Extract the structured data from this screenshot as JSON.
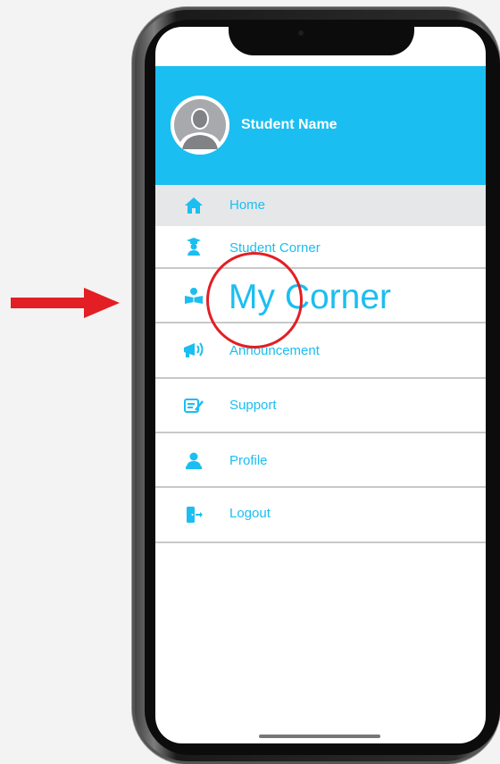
{
  "profile": {
    "student_name": "Student Name"
  },
  "menu": {
    "items": [
      {
        "label": "Home",
        "icon": "home-icon"
      },
      {
        "label": "Student Corner",
        "icon": "graduate-icon"
      },
      {
        "label": "My Corner",
        "icon": "reading-icon"
      },
      {
        "label": "Announcement",
        "icon": "megaphone-icon"
      },
      {
        "label": "Support",
        "icon": "edit-note-icon"
      },
      {
        "label": "Profile",
        "icon": "person-icon"
      },
      {
        "label": "Logout",
        "icon": "logout-icon"
      }
    ],
    "active": "Home"
  },
  "colors": {
    "accent": "#1bbef1",
    "active_row": "#e6e7e9",
    "annotation": "#e31e24",
    "divider": "#c8c8c8"
  }
}
